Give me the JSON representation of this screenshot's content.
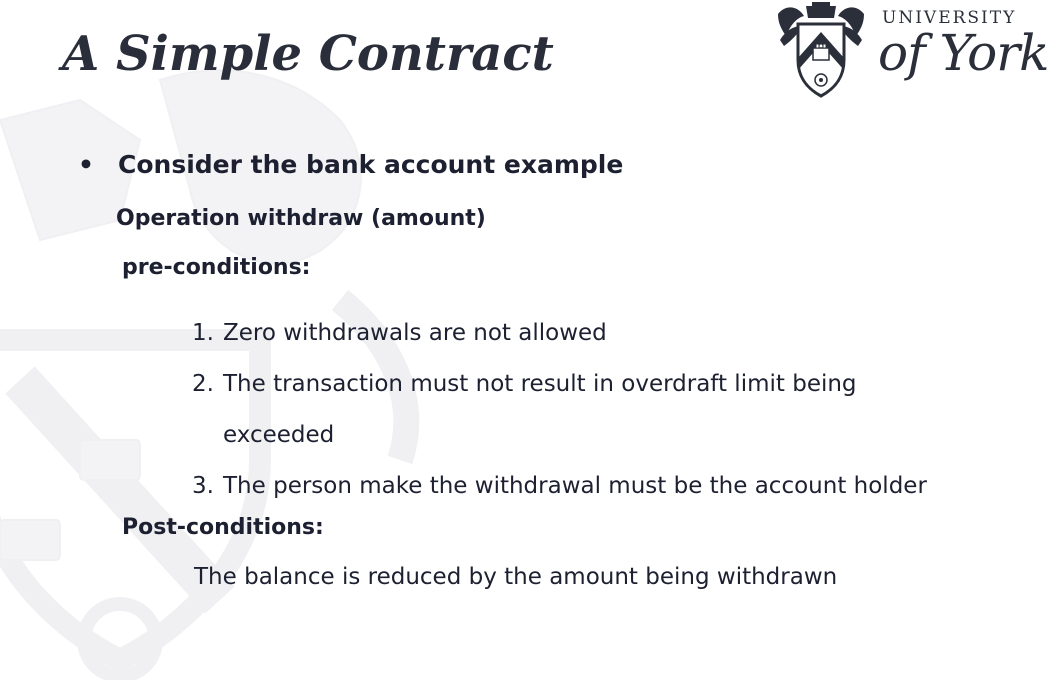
{
  "slide": {
    "title": "A Simple Contract",
    "logo": {
      "line1": "UNIVERSITY",
      "line2": "of York"
    },
    "bullet": "Consider the bank account example",
    "operation": "Operation withdraw (amount)",
    "pre_conditions": {
      "heading": "pre-conditions:",
      "items": [
        {
          "num": "1.",
          "text": "Zero withdrawals are not allowed"
        },
        {
          "num": "2.",
          "text": "The transaction must not result in overdraft limit being exceeded"
        },
        {
          "num": "3.",
          "text": "The person make the withdrawal must be the account holder"
        }
      ]
    },
    "post_conditions": {
      "heading": "Post-conditions:",
      "text": "The balance is reduced by the amount being withdrawn"
    }
  },
  "colors": {
    "text": "#1c2030",
    "title": "#2a2e3a",
    "watermark": "#f2f2f4"
  }
}
